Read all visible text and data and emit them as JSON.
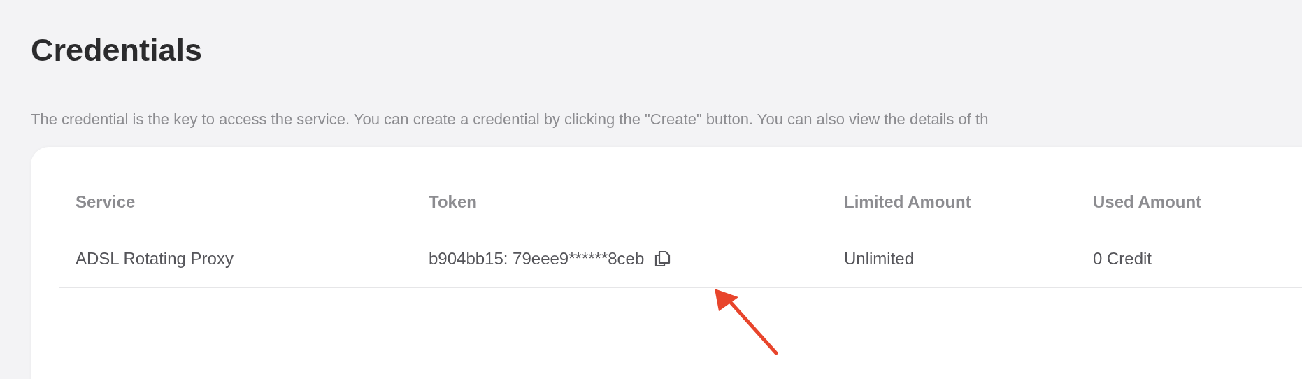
{
  "page": {
    "title": "Credentials",
    "description": "The credential is the key to access the service. You can create a credential by clicking the \"Create\" button. You can also view the details of th"
  },
  "table": {
    "columns": [
      "Service",
      "Token",
      "Limited Amount",
      "Used Amount"
    ],
    "rows": [
      {
        "service": "ADSL Rotating Proxy",
        "token": "b904bb15: 79eee9******8ceb",
        "limited_amount": "Unlimited",
        "used_amount": "0 Credit"
      }
    ]
  },
  "annotation": {
    "kind": "arrow"
  }
}
